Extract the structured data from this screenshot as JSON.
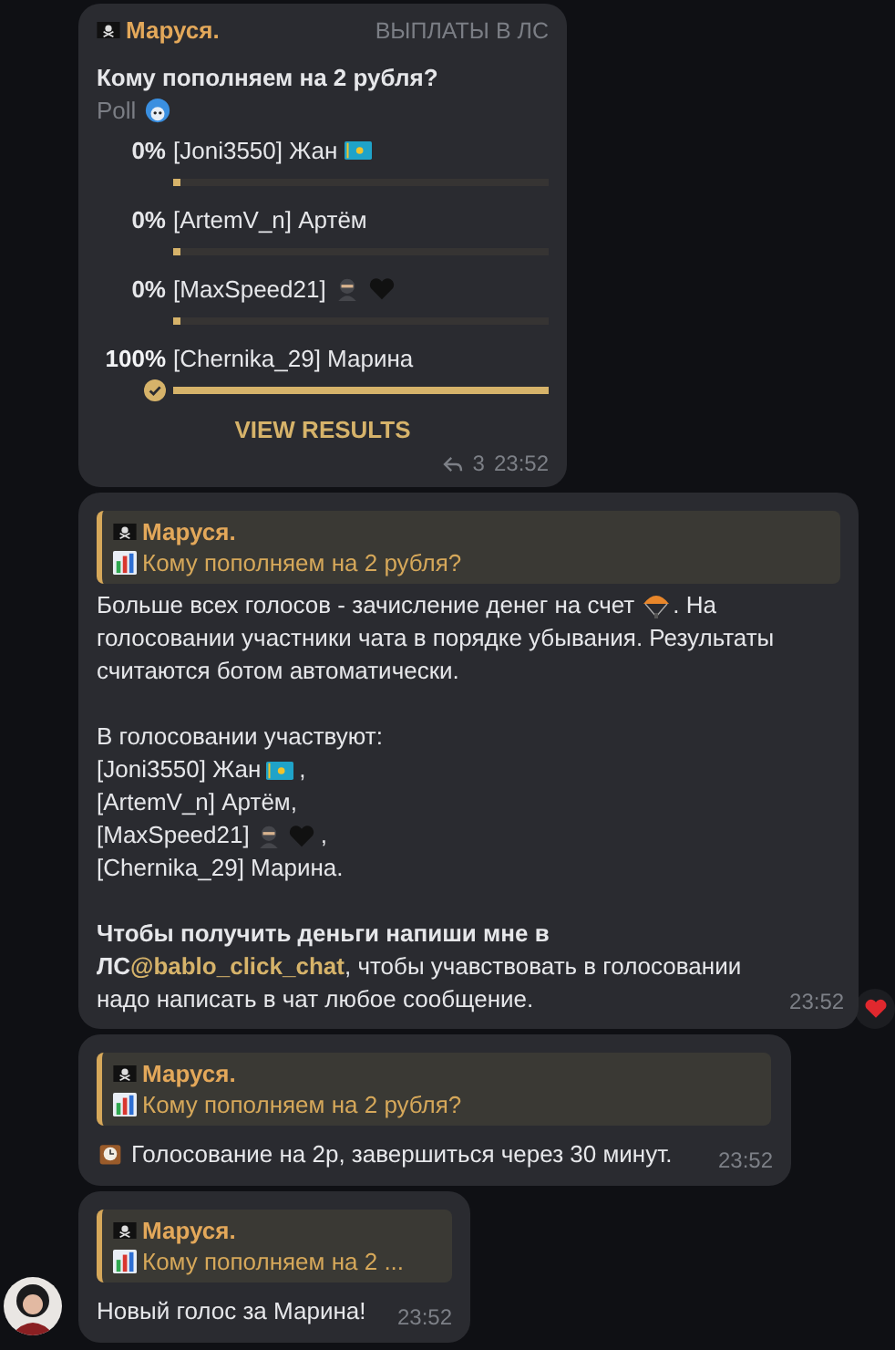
{
  "poll_message": {
    "sender": "Маруся.",
    "sender_badge": "ВЫПЛАТЫ В ЛС",
    "question": "Кому пополняем на 2 рубля?",
    "poll_type": "Poll",
    "options": [
      {
        "percent": "0%",
        "label": "[Joni3550] Жан",
        "level": 0,
        "selected": false
      },
      {
        "percent": "0%",
        "label": "[ArtemV_n] Артём",
        "level": 0,
        "selected": false
      },
      {
        "percent": "0%",
        "label": "[MaxSpeed21]",
        "level": 0,
        "selected": false
      },
      {
        "percent": "100%",
        "label": "[Chernika_29] Марина",
        "level": 1,
        "selected": true
      }
    ],
    "view_results": "VIEW RESULTS",
    "replies": "3",
    "time": "23:52"
  },
  "info_message": {
    "reply": {
      "sender": "Маруся.",
      "text": "Кому пополняем на 2 рубля?"
    },
    "intro_before": "Больше всех голосов - зачисление денег на счет",
    "intro_after": ". На",
    "intro_rest": "голосовании участники чата в порядке убывания. Результаты считаются ботом автоматически.",
    "participants_heading": " В голосовании участвуют:",
    "participants": [
      {
        "name": "[Joni3550] Жан",
        "end": ","
      },
      {
        "name": "[ArtemV_n] Артём,"
      },
      {
        "name": "[MaxSpeed21]",
        "end": ","
      },
      {
        "name": "[Chernika_29] Марина."
      }
    ],
    "closing_bold": "Чтобы получить деньги напиши мне в ЛС",
    "link": "@bablo_click_chat",
    "closing_rest": ", чтобы учавствовать в голосовании надо написать в чат любое сообщение.",
    "time": "23:52",
    "reaction": true
  },
  "timer_message": {
    "reply": {
      "sender": "Маруся.",
      "text": "Кому пополняем на 2 рубля?"
    },
    "text": "Голосование на 2р, завершиться через 30 минут.",
    "time": "23:52"
  },
  "vote_message": {
    "reply": {
      "sender": "Маруся.",
      "text": "Кому пополняем на 2 ..."
    },
    "text": "Новый голос за Марина!",
    "time": "23:52"
  }
}
